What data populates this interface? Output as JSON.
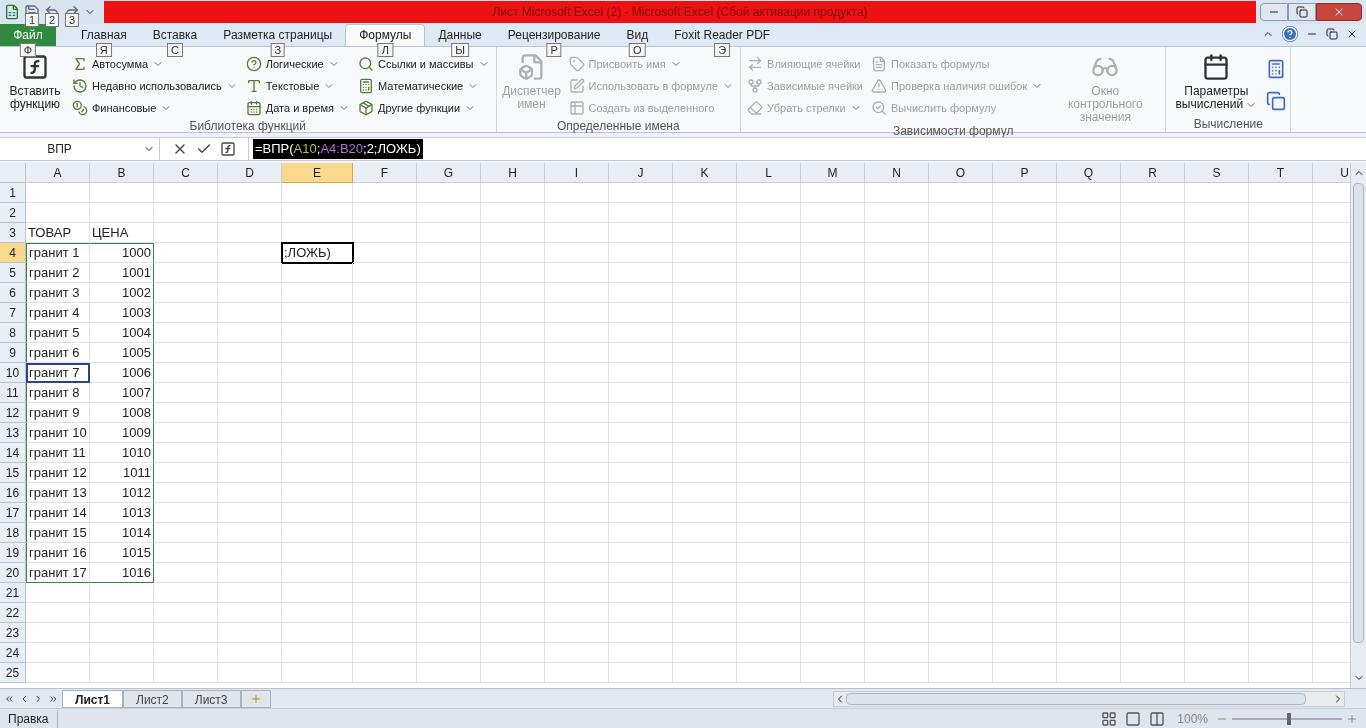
{
  "window": {
    "title": "Лист Microsoft Excel (2)  -  Microsoft Excel (Сбой активации продукта)"
  },
  "quick_access": [
    {
      "keytip": "1"
    },
    {
      "keytip": "2"
    },
    {
      "keytip": "3"
    }
  ],
  "tabs": [
    {
      "label": "Файл",
      "selected": false,
      "kind": "file",
      "keytip": "Ф"
    },
    {
      "label": "Главная",
      "selected": false,
      "kind": "tab",
      "keytip": "Я"
    },
    {
      "label": "Вставка",
      "selected": false,
      "kind": "tab",
      "keytip": "С"
    },
    {
      "label": "Разметка страницы",
      "selected": false,
      "kind": "tab",
      "keytip": "З"
    },
    {
      "label": "Формулы",
      "selected": true,
      "kind": "tab",
      "keytip": "Л"
    },
    {
      "label": "Данные",
      "selected": false,
      "kind": "tab",
      "keytip": "Ы"
    },
    {
      "label": "Рецензирование",
      "selected": false,
      "kind": "tab",
      "keytip": "Р"
    },
    {
      "label": "Вид",
      "selected": false,
      "kind": "tab",
      "keytip": "О"
    },
    {
      "label": "Foxit Reader PDF",
      "selected": false,
      "kind": "tab",
      "keytip": "Э"
    }
  ],
  "ribbon": [
    {
      "label": "Библиотека функций",
      "columns": [
        [
          {
            "kind": "large",
            "label": "Вставить функцию",
            "disabled": false,
            "dropdown": false
          }
        ],
        [
          {
            "kind": "small",
            "label": "Автосумма",
            "disabled": false,
            "dropdown": true
          },
          {
            "kind": "small",
            "label": "Недавно использовались",
            "disabled": false,
            "dropdown": true
          },
          {
            "kind": "small",
            "label": "Финансовые",
            "disabled": false,
            "dropdown": true
          }
        ],
        [
          {
            "kind": "small",
            "label": "Логические",
            "disabled": false,
            "dropdown": true
          },
          {
            "kind": "small",
            "label": "Текстовые",
            "disabled": false,
            "dropdown": true
          },
          {
            "kind": "small",
            "label": "Дата и время",
            "disabled": false,
            "dropdown": true
          }
        ],
        [
          {
            "kind": "small",
            "label": "Ссылки и массивы",
            "disabled": false,
            "dropdown": true
          },
          {
            "kind": "small",
            "label": "Математические",
            "disabled": false,
            "dropdown": true
          },
          {
            "kind": "small",
            "label": "Другие функции",
            "disabled": false,
            "dropdown": true
          }
        ]
      ]
    },
    {
      "label": "Определенные имена",
      "columns": [
        [
          {
            "kind": "large",
            "label": "Диспетчер имен",
            "disabled": true,
            "dropdown": false
          }
        ],
        [
          {
            "kind": "small",
            "label": "Присвоить имя",
            "disabled": true,
            "dropdown": true
          },
          {
            "kind": "small",
            "label": "Использовать в формуле",
            "disabled": true,
            "dropdown": true
          },
          {
            "kind": "small",
            "label": "Создать из выделенного",
            "disabled": true,
            "dropdown": false
          }
        ]
      ]
    },
    {
      "label": "Зависимости формул",
      "columns": [
        [
          {
            "kind": "small",
            "label": "Влияющие ячейки",
            "disabled": true,
            "dropdown": false
          },
          {
            "kind": "small",
            "label": "Зависимые ячейки",
            "disabled": true,
            "dropdown": false
          },
          {
            "kind": "small",
            "label": "Убрать стрелки",
            "disabled": true,
            "dropdown": true
          }
        ],
        [
          {
            "kind": "small",
            "label": "Показать формулы",
            "disabled": true,
            "dropdown": false
          },
          {
            "kind": "small",
            "label": "Проверка наличия ошибок",
            "disabled": true,
            "dropdown": true
          },
          {
            "kind": "small",
            "label": "Вычислить формулу",
            "disabled": true,
            "dropdown": false
          }
        ],
        [
          {
            "kind": "large",
            "label": "Окно контрольного значения",
            "disabled": true,
            "dropdown": false
          }
        ]
      ]
    },
    {
      "label": "Вычисление",
      "columns": [
        [
          {
            "kind": "large",
            "label": "Параметры вычислений",
            "disabled": false,
            "dropdown": true
          }
        ],
        [
          {
            "kind": "icon",
            "disabled": false
          },
          {
            "kind": "icon",
            "disabled": false
          }
        ]
      ]
    }
  ],
  "formula_bar": {
    "name_box": "ВПР",
    "parts": [
      {
        "text": "=ВПР("
      },
      {
        "text": "A10",
        "color": "#b8b84a"
      },
      {
        "text": ";"
      },
      {
        "text": "A4:B20",
        "color": "#b070d0"
      },
      {
        "text": ";2;ЛОЖЬ)"
      }
    ]
  },
  "grid": {
    "columns": [
      {
        "label": "A",
        "selected": false
      },
      {
        "label": "B",
        "selected": false
      },
      {
        "label": "C",
        "selected": false
      },
      {
        "label": "D",
        "selected": false
      },
      {
        "label": "E",
        "selected": true
      },
      {
        "label": "F",
        "selected": false
      },
      {
        "label": "G",
        "selected": false
      },
      {
        "label": "H",
        "selected": false
      },
      {
        "label": "I",
        "selected": false
      },
      {
        "label": "J",
        "selected": false
      },
      {
        "label": "K",
        "selected": false
      },
      {
        "label": "L",
        "selected": false
      },
      {
        "label": "M",
        "selected": false
      },
      {
        "label": "N",
        "selected": false
      },
      {
        "label": "O",
        "selected": false
      },
      {
        "label": "P",
        "selected": false
      },
      {
        "label": "Q",
        "selected": false
      },
      {
        "label": "R",
        "selected": false
      },
      {
        "label": "S",
        "selected": false
      },
      {
        "label": "T",
        "selected": false
      },
      {
        "label": "U",
        "selected": false
      }
    ],
    "active_cell": {
      "text": ";ЛОЖЬ)"
    },
    "rows": [
      {
        "number": "1",
        "selected": false,
        "kind": "empty",
        "in_range": false,
        "ref": false
      },
      {
        "number": "2",
        "selected": false,
        "kind": "empty",
        "in_range": false,
        "ref": false
      },
      {
        "number": "3",
        "selected": false,
        "kind": "header",
        "a": "ТОВАР",
        "b": "ЦЕНА",
        "in_range": false,
        "ref": false
      },
      {
        "number": "4",
        "selected": true,
        "kind": "item",
        "a": "гранит 1",
        "b": "1000",
        "in_range": true,
        "ref": false
      },
      {
        "number": "5",
        "selected": false,
        "kind": "item",
        "a": "гранит 2",
        "b": "1001",
        "in_range": true,
        "ref": false
      },
      {
        "number": "6",
        "selected": false,
        "kind": "item",
        "a": "гранит 3",
        "b": "1002",
        "in_range": true,
        "ref": false
      },
      {
        "number": "7",
        "selected": false,
        "kind": "item",
        "a": "гранит 4",
        "b": "1003",
        "in_range": true,
        "ref": false
      },
      {
        "number": "8",
        "selected": false,
        "kind": "item",
        "a": "гранит 5",
        "b": "1004",
        "in_range": true,
        "ref": false
      },
      {
        "number": "9",
        "selected": false,
        "kind": "item",
        "a": "гранит 6",
        "b": "1005",
        "in_range": true,
        "ref": false
      },
      {
        "number": "10",
        "selected": false,
        "kind": "item",
        "a": "гранит 7",
        "b": "1006",
        "in_range": true,
        "ref": true
      },
      {
        "number": "11",
        "selected": false,
        "kind": "item",
        "a": "гранит 8",
        "b": "1007",
        "in_range": true,
        "ref": false
      },
      {
        "number": "12",
        "selected": false,
        "kind": "item",
        "a": "гранит 9",
        "b": "1008",
        "in_range": true,
        "ref": false
      },
      {
        "number": "13",
        "selected": false,
        "kind": "item",
        "a": "гранит 10",
        "b": "1009",
        "in_range": true,
        "ref": false
      },
      {
        "number": "14",
        "selected": false,
        "kind": "item",
        "a": "гранит 11",
        "b": "1010",
        "in_range": true,
        "ref": false
      },
      {
        "number": "15",
        "selected": false,
        "kind": "item",
        "a": "гранит 12",
        "b": "1011",
        "in_range": true,
        "ref": false
      },
      {
        "number": "16",
        "selected": false,
        "kind": "item",
        "a": "гранит 13",
        "b": "1012",
        "in_range": true,
        "ref": false
      },
      {
        "number": "17",
        "selected": false,
        "kind": "item",
        "a": "гранит 14",
        "b": "1013",
        "in_range": true,
        "ref": false
      },
      {
        "number": "18",
        "selected": false,
        "kind": "item",
        "a": "гранит 15",
        "b": "1014",
        "in_range": true,
        "ref": false
      },
      {
        "number": "19",
        "selected": false,
        "kind": "item",
        "a": "гранит 16",
        "b": "1015",
        "in_range": true,
        "ref": false
      },
      {
        "number": "20",
        "selected": false,
        "kind": "item",
        "a": "гранит 17",
        "b": "1016",
        "in_range": true,
        "ref": false
      },
      {
        "number": "21",
        "selected": false,
        "kind": "empty",
        "in_range": false,
        "ref": false
      },
      {
        "number": "22",
        "selected": false,
        "kind": "empty",
        "in_range": false,
        "ref": false
      },
      {
        "number": "23",
        "selected": false,
        "kind": "empty",
        "in_range": false,
        "ref": false
      },
      {
        "number": "24",
        "selected": false,
        "kind": "empty",
        "in_range": false,
        "ref": false
      },
      {
        "number": "25",
        "selected": false,
        "kind": "empty",
        "in_range": false,
        "ref": false
      }
    ]
  },
  "sheet_tabs": [
    {
      "label": "Лист1",
      "selected": true
    },
    {
      "label": "Лист2",
      "selected": false
    },
    {
      "label": "Лист3",
      "selected": false
    }
  ],
  "status_bar": {
    "mode": "Правка",
    "zoom": "100%",
    "zoom_slider": {
      "level": 0.5
    }
  }
}
